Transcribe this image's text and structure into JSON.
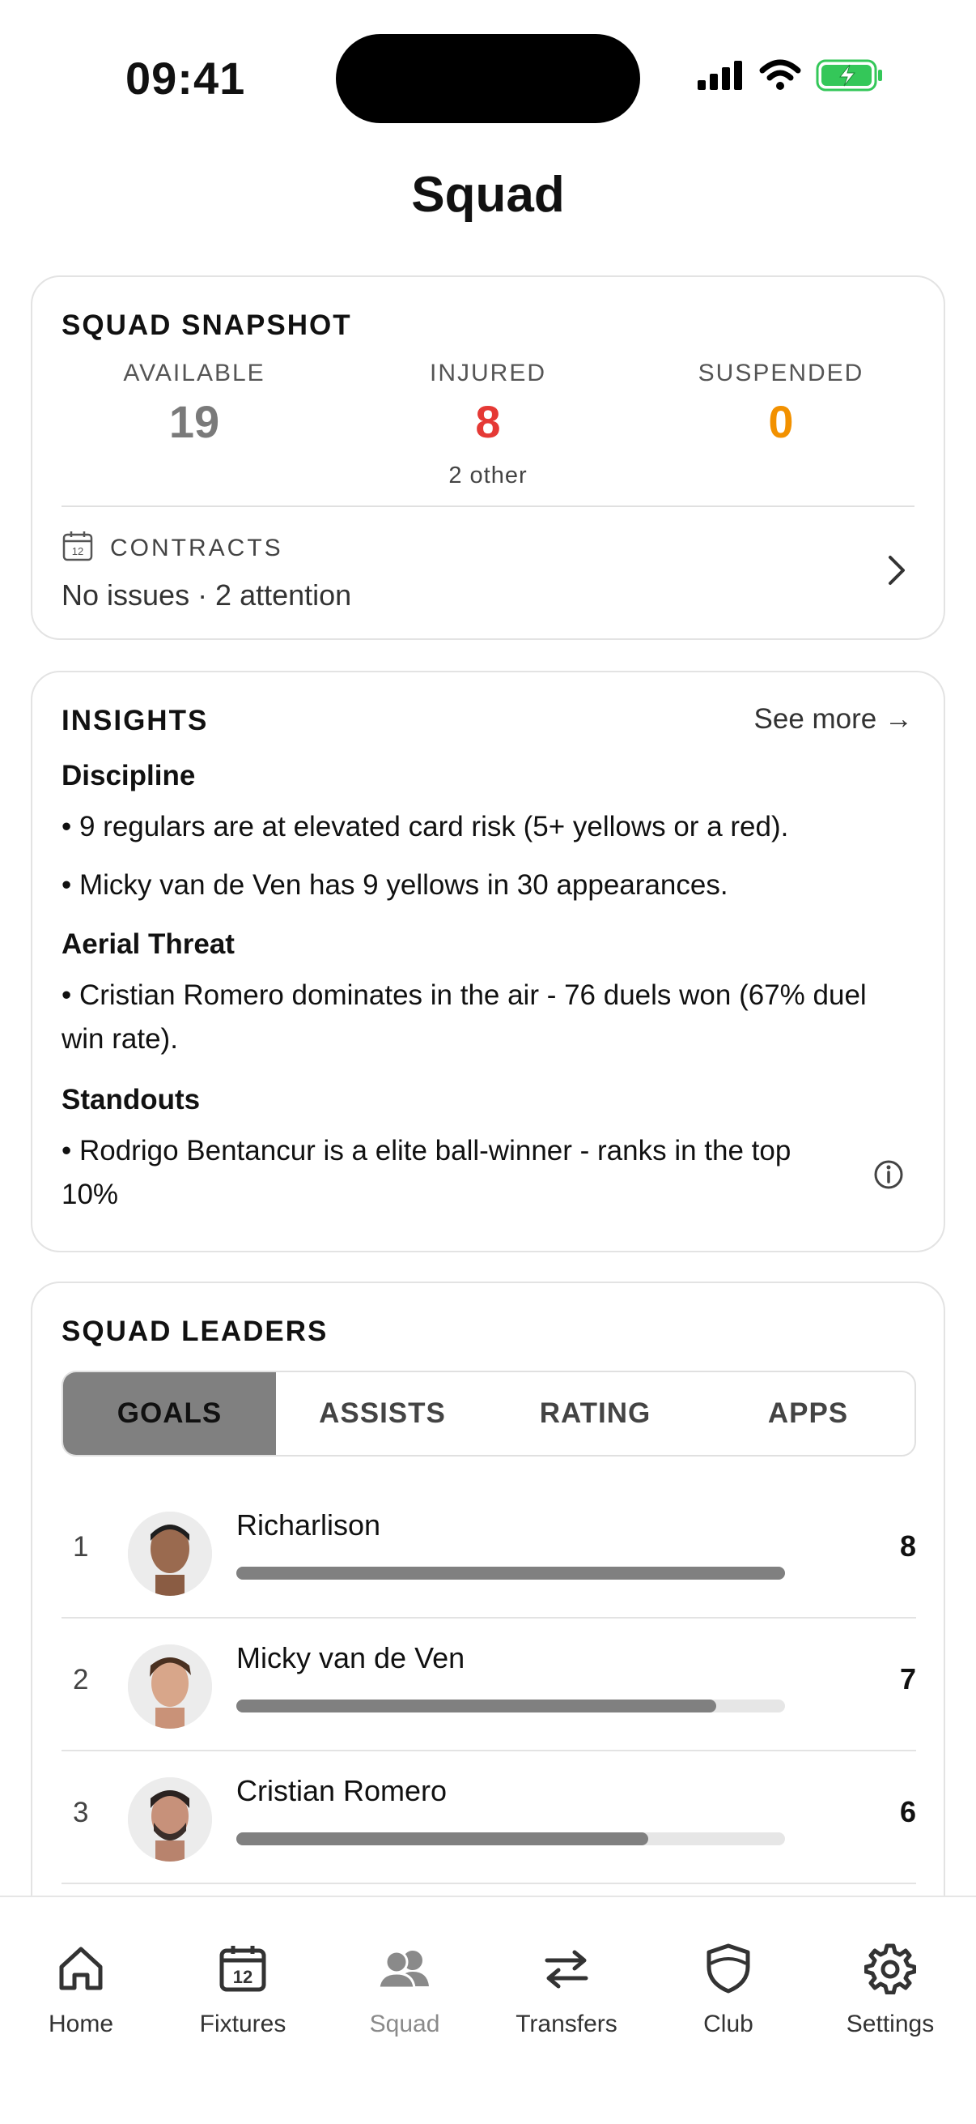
{
  "status_bar": {
    "time": "09:41"
  },
  "header": {
    "title": "Squad"
  },
  "snapshot": {
    "heading": "SQUAD SNAPSHOT",
    "stats": [
      {
        "label": "AVAILABLE",
        "value": "19",
        "color": "#7a7a7a"
      },
      {
        "label": "INJURED",
        "value": "8",
        "color": "#e53935",
        "sub": "2 other"
      },
      {
        "label": "SUSPENDED",
        "value": "0",
        "color": "#f29100"
      }
    ],
    "contracts": {
      "label": "CONTRACTS",
      "status": "No issues · 2 attention",
      "icon": "calendar-icon"
    }
  },
  "insights": {
    "heading": "INSIGHTS",
    "see_more": "See more →",
    "sections": [
      {
        "title": "Discipline",
        "bullets": [
          "• 9 regulars are at elevated card risk (5+ yellows or a red).",
          "• Micky van de Ven has 9 yellows in 30 appearances."
        ]
      },
      {
        "title": "Aerial Threat",
        "bullets": [
          "• Cristian Romero dominates in the air - 76 duels won (67% duel win rate)."
        ]
      },
      {
        "title": "Standouts",
        "bullets": [
          "• Rodrigo Bentancur is a elite ball-winner - ranks in the top 10%"
        ]
      }
    ]
  },
  "leaders": {
    "heading": "SQUAD LEADERS",
    "tabs": [
      "GOALS",
      "ASSISTS",
      "RATING",
      "APPS"
    ],
    "active_tab": "GOALS",
    "rows": [
      {
        "rank": "1",
        "name": "Richarlison",
        "value": "8",
        "fraction": 1.0
      },
      {
        "rank": "2",
        "name": "Micky van de Ven",
        "value": "7",
        "fraction": 0.875
      },
      {
        "rank": "3",
        "name": "Cristian Romero",
        "value": "6",
        "fraction": 0.75
      }
    ]
  },
  "tabbar": {
    "items": [
      {
        "label": "Home",
        "icon": "home-icon"
      },
      {
        "label": "Fixtures",
        "icon": "calendar-icon"
      },
      {
        "label": "Squad",
        "icon": "people-icon",
        "active": true
      },
      {
        "label": "Transfers",
        "icon": "arrows-icon"
      },
      {
        "label": "Club",
        "icon": "shield-icon"
      },
      {
        "label": "Settings",
        "icon": "gear-icon"
      }
    ]
  }
}
